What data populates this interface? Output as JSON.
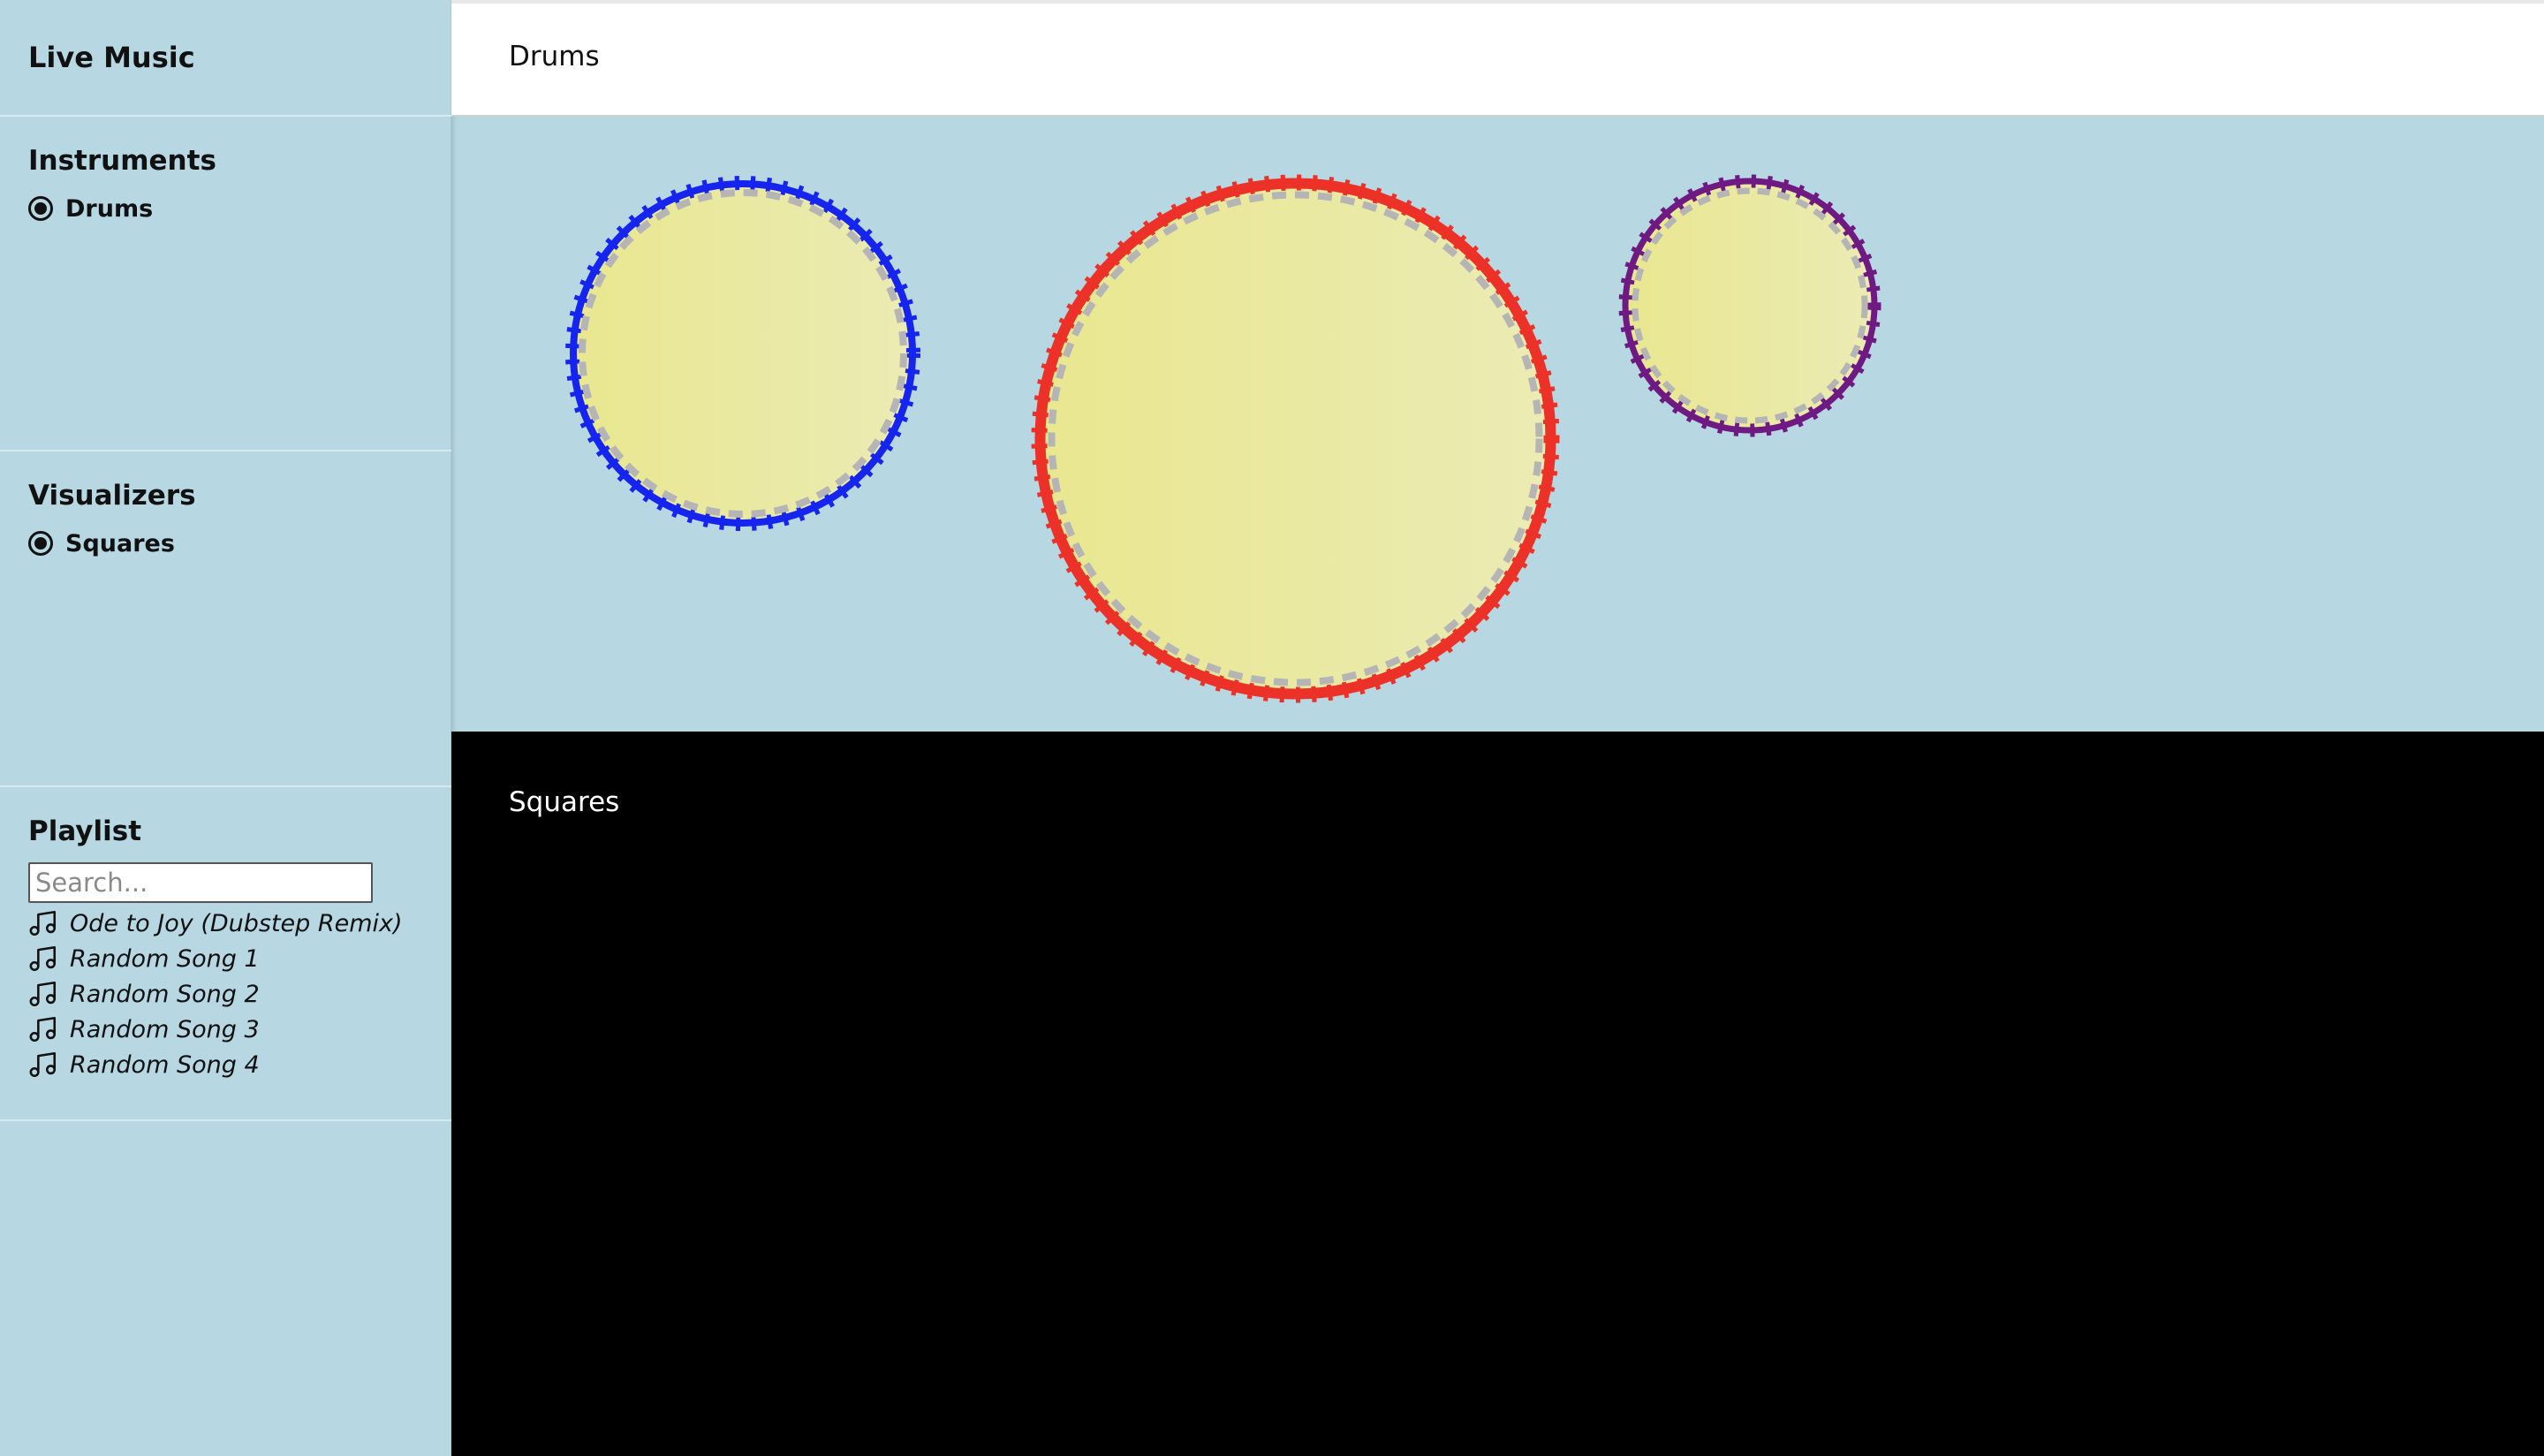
{
  "app": {
    "title": "Live Music"
  },
  "sidebar": {
    "instruments": {
      "heading": "Instruments",
      "options": [
        {
          "label": "Drums",
          "selected": true
        }
      ]
    },
    "visualizers": {
      "heading": "Visualizers",
      "options": [
        {
          "label": "Squares",
          "selected": true
        }
      ]
    },
    "playlist": {
      "heading": "Playlist",
      "search_placeholder": "Search...",
      "songs": [
        {
          "title": "Ode to Joy (Dubstep Remix)",
          "icon": "music-note-icon"
        },
        {
          "title": "Random Song 1",
          "icon": "music-note-icon"
        },
        {
          "title": "Random Song 2",
          "icon": "music-note-icon"
        },
        {
          "title": "Random Song 3",
          "icon": "music-note-icon"
        },
        {
          "title": "Random Song 4",
          "icon": "music-note-icon"
        }
      ]
    }
  },
  "main": {
    "header_title": "Drums",
    "drums": [
      {
        "name": "drum-blue",
        "rim_color": "#1524ee"
      },
      {
        "name": "drum-red",
        "rim_color": "#ec3228"
      },
      {
        "name": "drum-purple",
        "rim_color": "#6e1a82"
      }
    ],
    "visualizer_title": "Squares"
  },
  "colors": {
    "sidebar_bg": "#b7d8e3",
    "drum_head": "#ebe99a",
    "visualizer_bg": "#000000"
  }
}
